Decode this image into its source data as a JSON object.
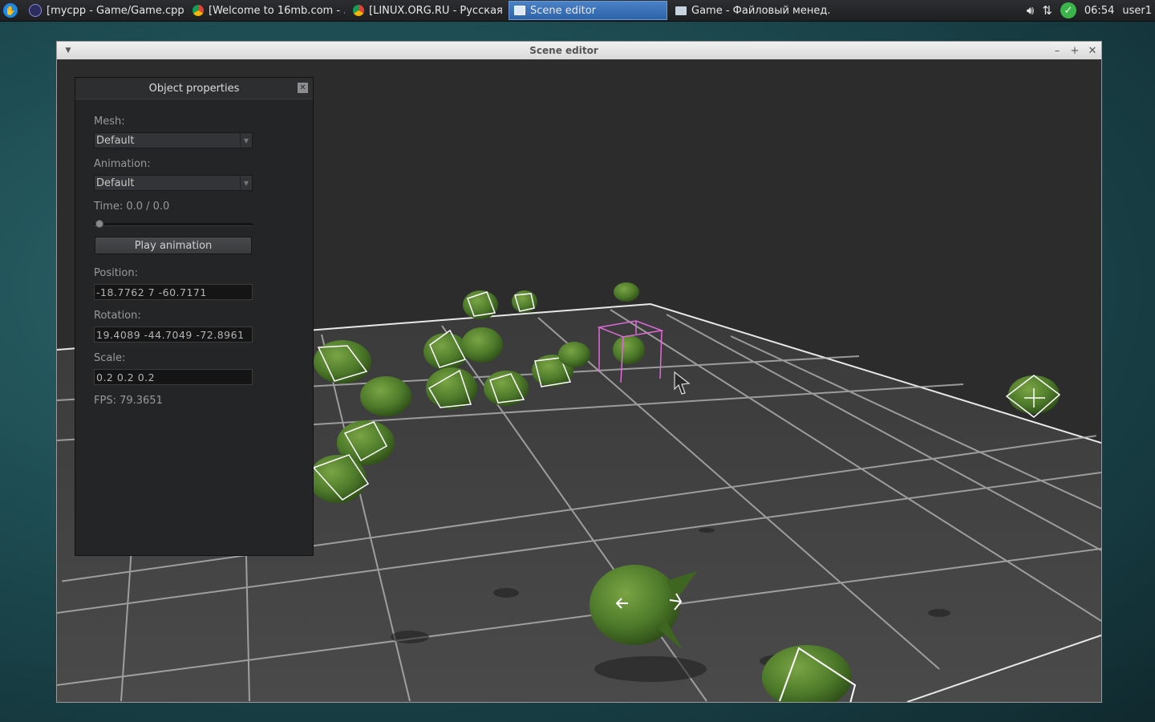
{
  "taskbar": {
    "tasks": [
      {
        "label": "[mycpp - Game/Game.cpp ...",
        "icon": "eclipse-icon"
      },
      {
        "label": "[Welcome to 16mb.com - ...",
        "icon": "chrome-icon"
      },
      {
        "label": "[LINUX.ORG.RU - Русская ...",
        "icon": "chrome-icon"
      },
      {
        "label": "Scene editor",
        "icon": "window-icon",
        "active": true
      },
      {
        "label": "Game - Файловый менед...",
        "icon": "folder-icon"
      }
    ],
    "clock": "06:54",
    "user": "user1"
  },
  "window": {
    "title": "Scene editor"
  },
  "panel": {
    "title": "Object properties",
    "mesh_label": "Mesh:",
    "mesh_value": "Default",
    "animation_label": "Animation:",
    "animation_value": "Default",
    "time_label": "Time: 0.0 / 0.0",
    "time_fraction": 0.0,
    "play_button": "Play animation",
    "position_label": "Position:",
    "position_value": "-18.7762 7 -60.7171",
    "rotation_label": "Rotation:",
    "rotation_value": "19.4089 -44.7049 -72.8961",
    "scale_label": "Scale:",
    "scale_value": "0.2 0.2 0.2",
    "fps_text": "FPS: 79.3651"
  },
  "colors": {
    "accent": "#2d63a8",
    "selection_box": "#e06ad8",
    "model_green": "#4d7a2a"
  }
}
